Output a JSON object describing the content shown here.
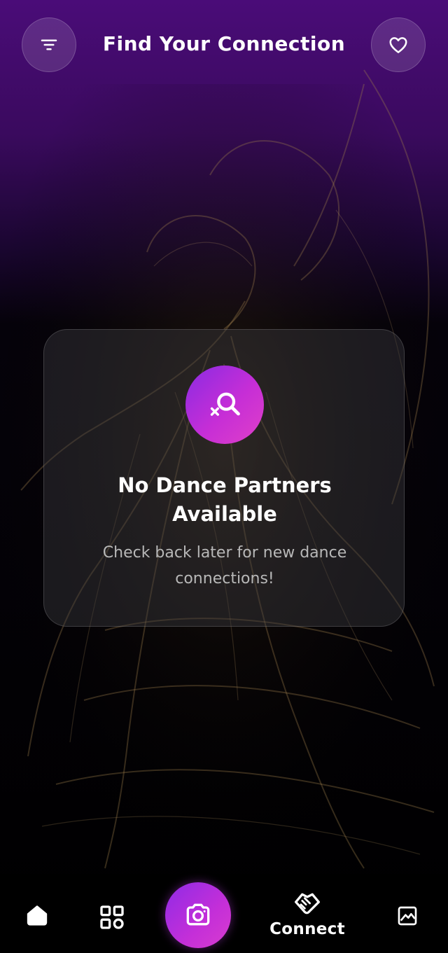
{
  "header": {
    "title": "Find Your Connection",
    "filter_icon": "filter-lines-icon",
    "favorite_icon": "heart-outline-icon"
  },
  "empty_state": {
    "icon": "search-cancel-icon",
    "title_line1": "No Dance Partners",
    "title_line2": "Available",
    "subtitle_line1": "Check back later for new dance",
    "subtitle_line2": "connections!"
  },
  "bottom_nav": {
    "items": [
      {
        "icon": "home-icon",
        "label": ""
      },
      {
        "icon": "grid-icon",
        "label": ""
      },
      {
        "icon": "camera-icon",
        "label": ""
      },
      {
        "icon": "handshake-icon",
        "label": "Connect"
      },
      {
        "icon": "gallery-icon",
        "label": ""
      }
    ]
  },
  "colors": {
    "accent_purple": "#8f2be6",
    "accent_magenta": "#d83ccf",
    "header_purple": "#4a0c78",
    "background": "#000000"
  }
}
